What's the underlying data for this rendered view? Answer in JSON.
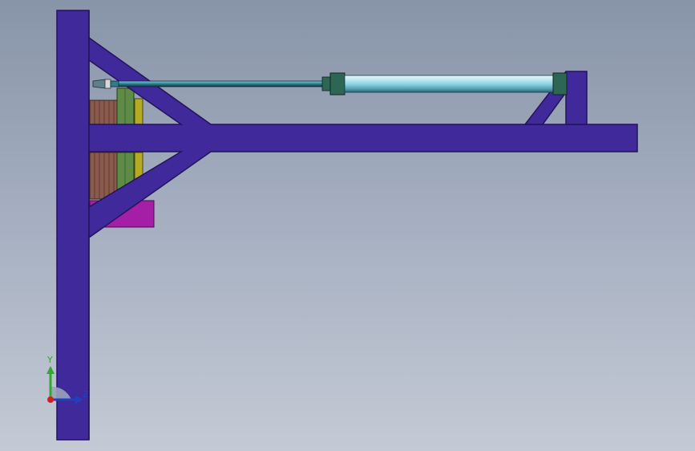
{
  "viewport": {
    "background_top": "#8894a8",
    "background_bottom": "#c4cad5"
  },
  "model": {
    "frame_color": "#40299a",
    "frame_edge_color": "#23145a",
    "bracket_color": "#a41fa6",
    "brick_color": "#8a5a4c",
    "green_block_color": "#5e8c47",
    "yellow_plate_color": "#b5aa23",
    "cylinder_color": "#8fd4e6",
    "cylinder_end_color": "#2e6656",
    "rod_color": "#2e7d8f"
  },
  "triad": {
    "y_label": "Y",
    "z_label": "Z",
    "y_color": "#2faa2f",
    "z_color": "#2040c0",
    "x_color": "#d02020",
    "icon": "coordinate-triad-icon"
  }
}
